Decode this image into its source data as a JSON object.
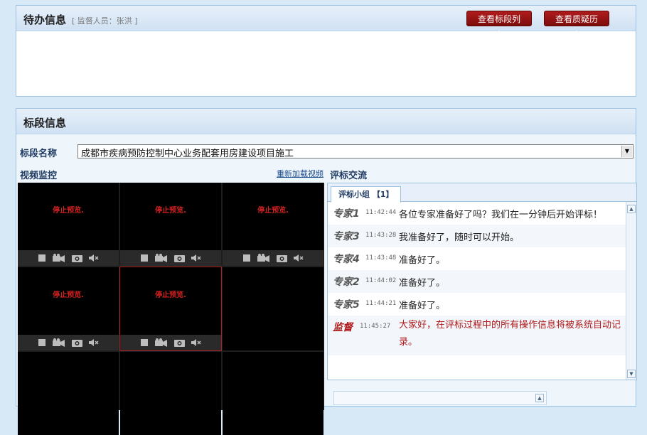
{
  "todo_panel": {
    "title": "待办信息",
    "supervisor": "[ 监督人员：张洪 ]",
    "btn_section_list": "查看标段列表",
    "btn_query_history": "查看质疑历史"
  },
  "section_panel": {
    "title": "标段信息",
    "field_label": "标段名称",
    "selected_section": "成都市疾病预防控制中心业务配套用房建设项目施工",
    "video_label": "视频监控",
    "reload_link": "重新加载视频",
    "chat_label": "评标交流"
  },
  "video": {
    "stopped_text": "停止预览.",
    "cells_with_feed": [
      0,
      1,
      2,
      3,
      4
    ],
    "active_cell": 4
  },
  "chat": {
    "tab_label": "评标小组 【1】",
    "messages": [
      {
        "who": "专家1",
        "time": "11:42:44",
        "text": "各位专家准备好了吗？我们在一分钟后开始评标！"
      },
      {
        "who": "专家3",
        "time": "11:43:28",
        "text": "我准备好了，随时可以开始。"
      },
      {
        "who": "专家4",
        "time": "11:43:48",
        "text": "准备好了。"
      },
      {
        "who": "专家2",
        "time": "11:44:02",
        "text": "准备好了。"
      },
      {
        "who": "专家5",
        "time": "11:44:21",
        "text": "准备好了。"
      },
      {
        "who": "监督",
        "time": "11:45:27",
        "text": "大家好，在评标过程中的所有操作信息将被系统自动记录。"
      }
    ]
  },
  "colors": {
    "accent_red": "#a81616",
    "header_blue": "#cfe1f3",
    "supervisor_red": "#b01818"
  }
}
